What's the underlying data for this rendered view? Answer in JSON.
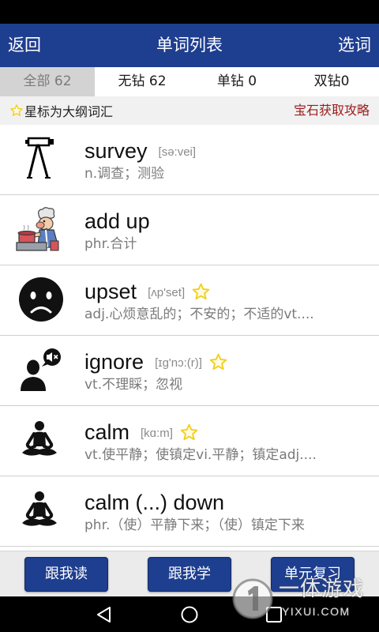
{
  "header": {
    "back_label": "返回",
    "title": "单词列表",
    "select_label": "选词"
  },
  "tabs": [
    {
      "label": "全部 62",
      "selected": true
    },
    {
      "label": "无钻 62",
      "selected": false
    },
    {
      "label": "单钻 0",
      "selected": false
    },
    {
      "label": "双钻0",
      "selected": false
    }
  ],
  "info": {
    "star_note": "星标为大纲词汇",
    "gem_guide": "宝石获取攻略"
  },
  "words": [
    {
      "word": "survey",
      "phonetic": "[sə:vei]",
      "starred": false,
      "definition": "n.调查；测验",
      "icon": "tripod-icon"
    },
    {
      "word": "add up",
      "starred": false,
      "definition": "phr.合计",
      "icon": "chef-cooking-icon"
    },
    {
      "word": "upset",
      "phonetic": "[ʌp'set]",
      "starred": true,
      "definition": "adj.心烦意乱的；不安的；不适的vt....",
      "icon": "sad-face-icon"
    },
    {
      "word": "ignore",
      "phonetic": "[ɪg'nɔ:(r)]",
      "starred": true,
      "definition": "vt.不理睬；忽视",
      "icon": "person-muted-icon"
    },
    {
      "word": "calm",
      "phonetic": "[kɑ:m]",
      "starred": true,
      "definition": "vt.使平静；使镇定vi.平静；镇定adj....",
      "icon": "meditation-icon"
    },
    {
      "word": "calm (...) down",
      "starred": false,
      "definition": "phr.（使）平静下来；（使）镇定下来",
      "icon": "meditation-icon"
    }
  ],
  "actions": {
    "read_label": "跟我读",
    "learn_label": "跟我学",
    "review_label": "单元复习"
  },
  "watermark": {
    "name": "一体游戏",
    "site": "YIXUI.COM"
  },
  "colors": {
    "accent": "#1e3e8f",
    "gem_link": "#9b1c1c",
    "star": "#f2cf1b"
  }
}
